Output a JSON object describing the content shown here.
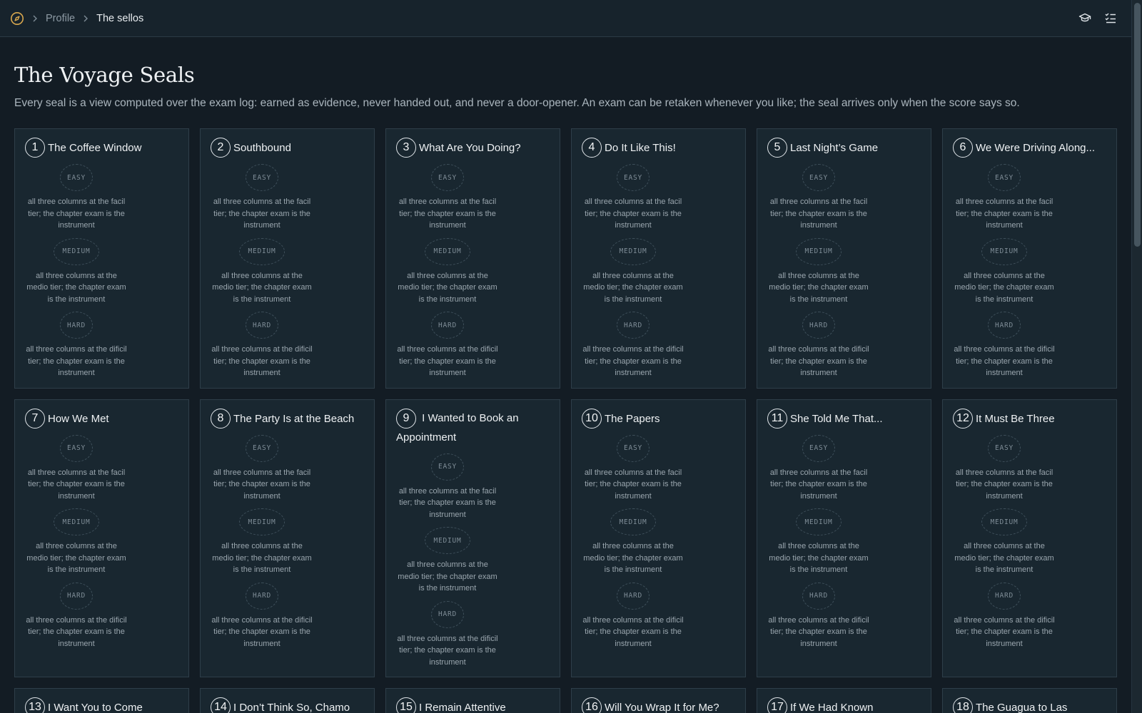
{
  "breadcrumb": {
    "parent": "Profile",
    "current": "The sellos"
  },
  "page": {
    "title": "The Voyage Seals",
    "subtitle": "Every seal is a view computed over the exam log: earned as evidence, never handed out, and never a door-opener. An exam can be retaken whenever you like; the seal arrives only when the score says so."
  },
  "tiers": {
    "easy": {
      "label": "EASY",
      "desc": "all three columns at the facil tier; the chapter exam is the instrument"
    },
    "medium": {
      "label": "MEDIUM",
      "desc": "all three columns at the medio tier; the chapter exam is the instrument"
    },
    "hard": {
      "label": "HARD",
      "desc": "all three columns at the dificil tier; the chapter exam is the instrument"
    }
  },
  "chapters": [
    {
      "num": "1",
      "title": "The Coffee Window"
    },
    {
      "num": "2",
      "title": "Southbound"
    },
    {
      "num": "3",
      "title": "What Are You Doing?"
    },
    {
      "num": "4",
      "title": "Do It Like This!"
    },
    {
      "num": "5",
      "title": "Last Night’s Game"
    },
    {
      "num": "6",
      "title": "We Were Driving Along..."
    },
    {
      "num": "7",
      "title": "How We Met"
    },
    {
      "num": "8",
      "title": "The Party Is at the Beach"
    },
    {
      "num": "9",
      "title": "I Wanted to Book an Appointment"
    },
    {
      "num": "10",
      "title": "The Papers"
    },
    {
      "num": "11",
      "title": "She Told Me That..."
    },
    {
      "num": "12",
      "title": "It Must Be Three"
    },
    {
      "num": "13",
      "title": "I Want You to Come"
    },
    {
      "num": "14",
      "title": "I Don’t Think So, Chamo"
    },
    {
      "num": "15",
      "title": "I Remain Attentive"
    },
    {
      "num": "16",
      "title": "Will You Wrap It for Me?"
    },
    {
      "num": "17",
      "title": "If We Had Known"
    },
    {
      "num": "18",
      "title": "The Guagua to Las"
    }
  ],
  "colors": {
    "background": "#131c24",
    "card": "#192730",
    "border": "#2e3e49",
    "logo": "#d9a84e"
  },
  "icons": {
    "logo": "compass-icon",
    "sep": "chevron-right-icon",
    "study": "graduation-cap-icon",
    "tasks": "checklist-icon"
  }
}
